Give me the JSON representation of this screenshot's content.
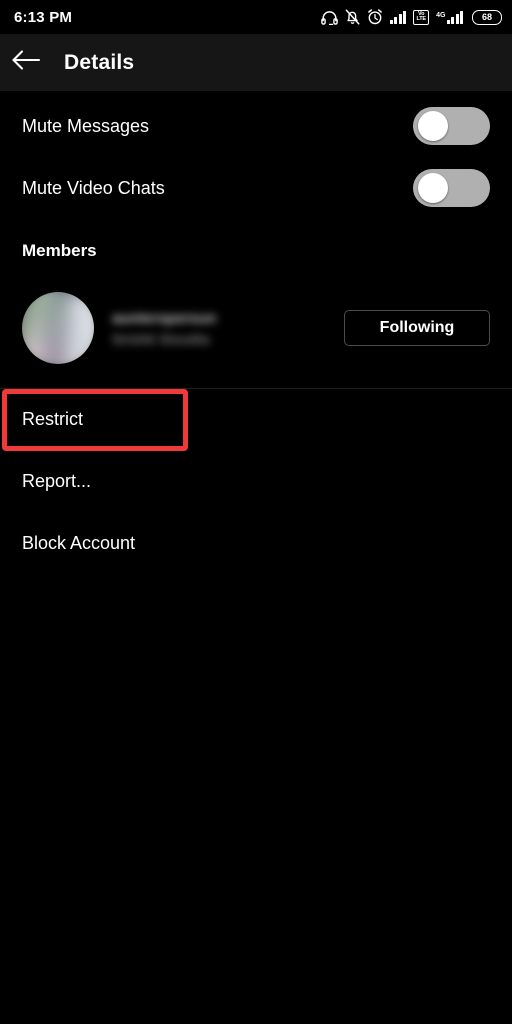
{
  "status_bar": {
    "time": "6:13 PM",
    "icons": [
      {
        "name": "headset-icon",
        "label": "headset"
      },
      {
        "name": "bell-muted-icon",
        "label": "notifications silenced"
      },
      {
        "name": "alarm-clock-icon",
        "label": "alarm"
      },
      {
        "name": "signal-bars-icon",
        "label": "signal strength"
      },
      {
        "name": "volte-icon",
        "label": "VoLTE"
      },
      {
        "name": "mobile-data-4g-icon",
        "label": "4G"
      },
      {
        "name": "battery-icon",
        "label": "battery"
      }
    ],
    "volte_top": "Vo",
    "volte_bottom": "LTE",
    "network_type": "4G",
    "battery_level": "68"
  },
  "app_bar": {
    "back_icon": "back-arrow-icon",
    "title": "Details"
  },
  "settings": {
    "toggles": [
      {
        "label": "Mute Messages",
        "state": "off"
      },
      {
        "label": "Mute Video Chats",
        "state": "off"
      }
    ]
  },
  "members": {
    "section_title": "Members",
    "entries": [
      {
        "username": "aunterspersun",
        "fullname": "Srishti Sisodia",
        "redacted": true,
        "action_label": "Following"
      }
    ]
  },
  "actions": [
    {
      "label": "Restrict",
      "highlighted": true
    },
    {
      "label": "Report...",
      "highlighted": false
    },
    {
      "label": "Block Account",
      "highlighted": false
    }
  ],
  "annotation": {
    "highlight_color": "#f03a3a",
    "target": "Restrict"
  }
}
